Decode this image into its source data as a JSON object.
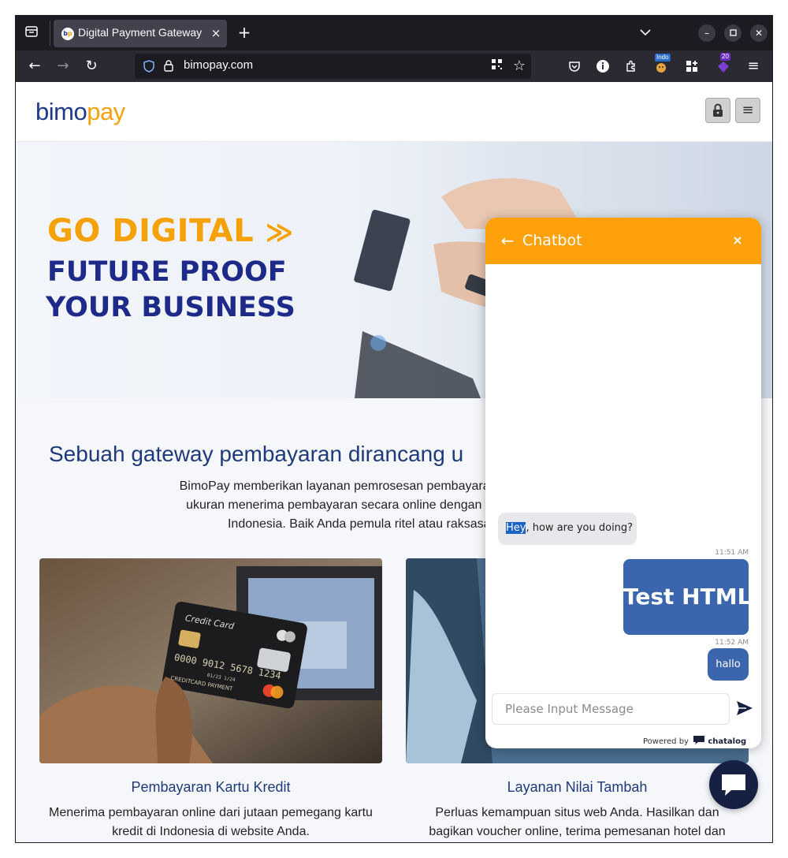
{
  "browser": {
    "tab_title": "Digital Payment Gateway",
    "tab_close": "×",
    "new_tab": "+",
    "url": "bimopay.com",
    "ext_badge_1": "Indo",
    "ext_badge_2": "20",
    "icons": [
      "tab-list-icon",
      "chevron-down-icon",
      "back-arrow-icon",
      "forward-arrow-icon",
      "reload-icon",
      "shield-icon",
      "lock-icon",
      "qr-code-icon",
      "star-icon",
      "pocket-icon",
      "extension-icons",
      "menu-icon"
    ]
  },
  "site": {
    "logo_part1": "bimo",
    "logo_part2": "pay",
    "hero": {
      "line1": "GO DIGITAL",
      "line1_arrows": "≫",
      "line2": "FUTURE PROOF",
      "line3": "YOUR BUSINESS"
    },
    "section_title": "Sebuah gateway pembayaran dirancang u",
    "section_desc_line1": "BimoPay memberikan layanan pemrosesan pembayaran yang andal yang",
    "section_desc_line2": "ukuran menerima pembayaran secara online dengan aman menggunak",
    "section_desc_line3": "Indonesia. Baik Anda pemula ritel atau raksasa teknologi",
    "cards": [
      {
        "title": "Pembayaran Kartu Kredit",
        "desc_line1": "Menerima pembayaran online dari jutaan pemegang kartu",
        "desc_line2": "kredit di Indonesia di website Anda.",
        "card_text_label": "Credit Card",
        "card_number": "0000 9012 5678 1234",
        "card_date": "01/23 1/24",
        "card_holder": "CREDITCARD PAYMENT"
      },
      {
        "title": "Layanan Nilai Tambah",
        "desc_line1": "Perluas kemampuan situs web Anda. Hasilkan dan",
        "desc_line2": "bagikan voucher online, terima pemesanan hotel dan"
      }
    ]
  },
  "chatbot": {
    "title": "Chatbot",
    "back_icon": "←",
    "close_icon": "×",
    "messages": [
      {
        "sender": "bot",
        "highlight": "Hey",
        "text": ", how are you doing?"
      },
      {
        "sender": "user",
        "time": "11:51 AM",
        "text": "Test HTML"
      },
      {
        "sender": "user",
        "time": "11:52 AM",
        "text": "hallo"
      }
    ],
    "input_placeholder": "Please Input Message",
    "powered_by": "Powered by",
    "brand": "chatalog"
  },
  "colors": {
    "accent_orange": "#ffa10a",
    "brand_navy": "#1e3a8a",
    "user_bubble": "#3b66ad",
    "launcher": "#152042"
  }
}
